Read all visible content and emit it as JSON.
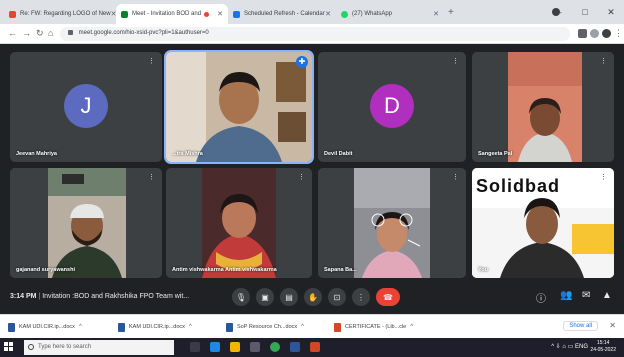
{
  "browser": {
    "tabs": [
      {
        "label": "Re: FW: Regarding LOGO of New",
        "icon": "gmail-icon",
        "color": "#ea4335"
      },
      {
        "label": "Meet - Invitation BOD and",
        "icon": "meet-icon",
        "color": "#00832d"
      },
      {
        "label": "Scheduled Refresh - Calendar",
        "icon": "calendar-icon",
        "color": "#1a73e8"
      },
      {
        "label": "(27) WhatsApp",
        "icon": "whatsapp-icon",
        "color": "#25d366"
      }
    ],
    "url": "meet.google.com/hio-xsid-pvc?pli=1&authuser=0"
  },
  "participants": [
    {
      "name": "Jeevan Mahriya",
      "type": "avatar",
      "initial": "J",
      "avatar_color": "#5c6bc0"
    },
    {
      "name": "...tra Mishra",
      "type": "video",
      "active": true
    },
    {
      "name": "Devil Dabit",
      "type": "avatar",
      "initial": "D",
      "avatar_color": "#b12fbf"
    },
    {
      "name": "Sangeeta Pal",
      "type": "video"
    },
    {
      "name": "gajanand suryawanshi",
      "type": "video"
    },
    {
      "name": "Antim vishwakarma Antim vishwakarma",
      "type": "video"
    },
    {
      "name": "Sapana Ba...",
      "type": "video"
    },
    {
      "name": "You",
      "type": "video",
      "banner": "Solidbad"
    }
  ],
  "meeting": {
    "time": "3:14 PM",
    "title": "Invitation :BOD and Rakhshika FPO Team wit..."
  },
  "downloads": {
    "items": [
      {
        "name": "KAM UDI.CIR.ip...docx",
        "color": "#2b579a"
      },
      {
        "name": "KAM UDI.CIR.ip...docx",
        "color": "#2b579a"
      },
      {
        "name": "SoP Resource Ch...docx",
        "color": "#2b579a"
      },
      {
        "name": "CERTIFICATE - (Lib...cle",
        "color": "#d24726"
      }
    ],
    "show_all": "Show all"
  },
  "taskbar": {
    "search_placeholder": "Type here to search",
    "tray": "^ ⇩ ⌂ ▭ ENG",
    "time": "15:14",
    "date": "24-05-2022"
  }
}
